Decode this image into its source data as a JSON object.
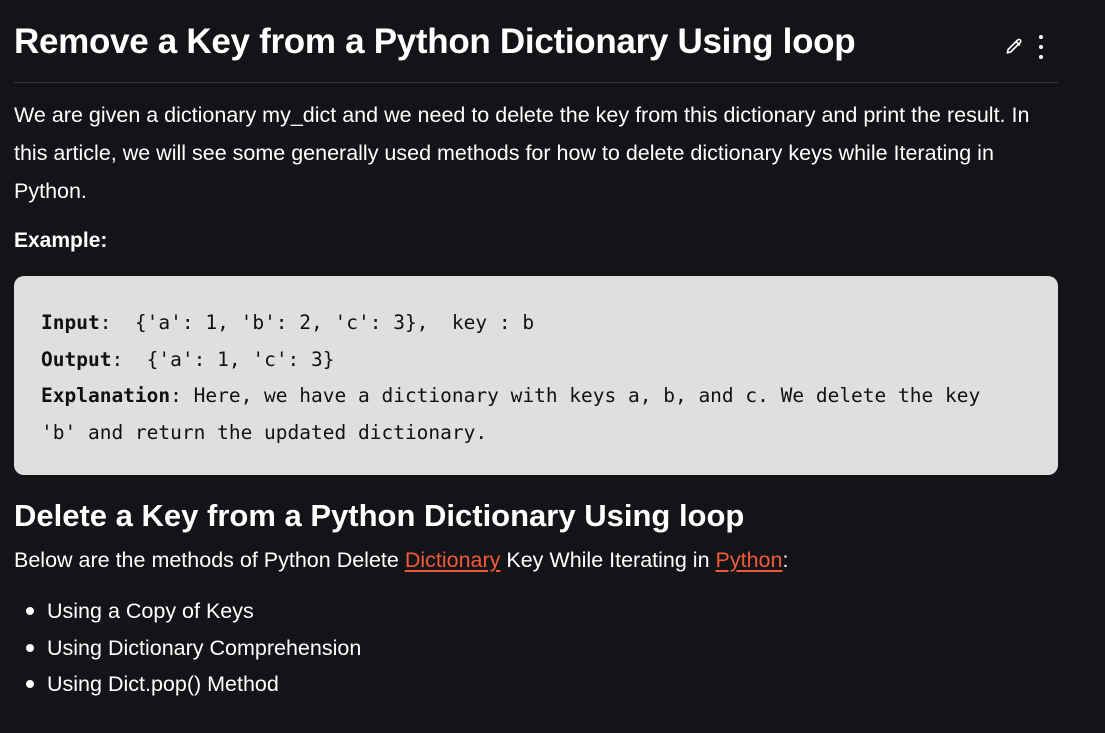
{
  "article": {
    "title": "Remove a Key from a Python Dictionary Using loop",
    "intro": "We are given a dictionary my_dict and we need to delete the key from this dictionary and print the result. In this article, we will see some generally used methods for how to delete dictionary keys while Iterating in Python.",
    "example_label": "Example:",
    "example": {
      "input_label": "Input",
      "input_value": ":  {'a': 1, 'b': 2, 'c': 3},  key : b",
      "output_label": "Output",
      "output_value": ":  {'a': 1, 'c': 3}",
      "explanation_label": "Explanation",
      "explanation_value": ": Here, we have a dictionary with keys a, b, and c. We delete the key",
      "explanation_cont": "'b' and return the updated dictionary."
    },
    "section_heading": "Delete a Key from a Python Dictionary Using loop",
    "methods_intro_before": "Below are the methods of Python Delete ",
    "methods_intro_link1": "Dictionary",
    "methods_intro_middle": " Key While Iterating in ",
    "methods_intro_link2": "Python",
    "methods_intro_after": ":",
    "methods": [
      "Using a Copy of Keys",
      "Using Dictionary Comprehension",
      "Using Dict.pop() Method"
    ]
  },
  "icons": {
    "edit": "pencil-icon",
    "more": "more-vertical-icon"
  },
  "colors": {
    "background": "#131417",
    "code_background": "#dfdfdf",
    "link": "#f05a3a",
    "text": "#ffffff"
  }
}
